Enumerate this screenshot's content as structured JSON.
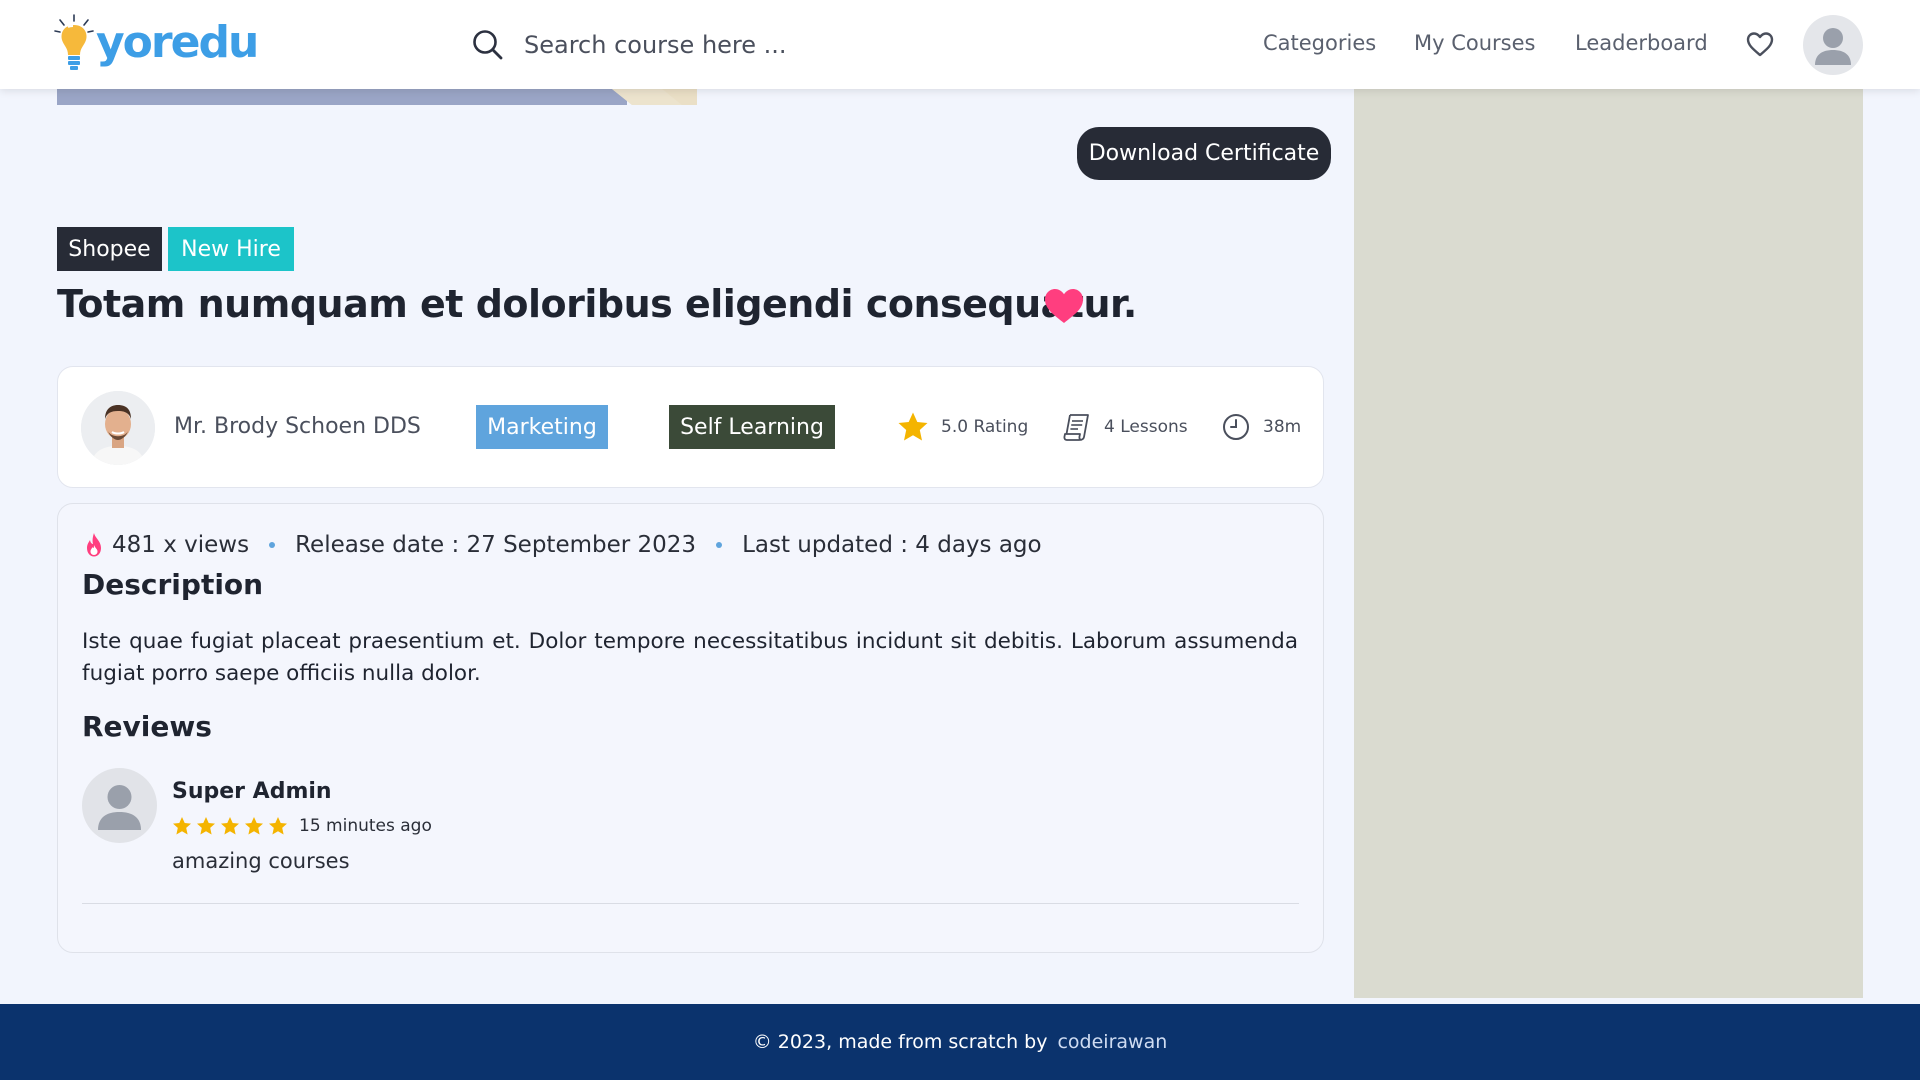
{
  "header": {
    "logo_text": "yoredu",
    "search_placeholder": "Search course here ...",
    "nav": [
      "Categories",
      "My Courses",
      "Leaderboard"
    ],
    "icons": {
      "search": "search-icon",
      "wishlist": "heart-icon",
      "profile": "user-avatar-icon"
    }
  },
  "colors": {
    "brand_blue": "#3d9ee6",
    "dark": "#272b36",
    "teal": "#1cc4c9",
    "marketing_blue": "#5fa4dd",
    "self_learning_green": "#3b4a38",
    "heart_pink": "#ff3e7f",
    "star_yellow": "#f4b400",
    "footer_navy": "#0b336d",
    "side_panel": "#dadbd0"
  },
  "actions": {
    "download_certificate": "Download Certificate"
  },
  "course": {
    "tags": [
      "Shopee",
      "New Hire"
    ],
    "title": "Totam numquam et doloribus eligendi consequatur.",
    "favorited": true,
    "instructor": "Mr. Brody Schoen DDS",
    "category": "Marketing",
    "learning_type": "Self Learning",
    "rating": "5.0 Rating",
    "lessons": "4 Lessons",
    "duration": "38m",
    "views": "481 x views",
    "release_date": "Release date : 27 September 2023",
    "last_updated": "Last updated : 4 days ago",
    "description_heading": "Description",
    "description": "Iste quae fugiat placeat praesentium et. Dolor tempore necessitatibus incidunt sit debitis. Laborum assumenda fugiat porro saepe officiis nulla dolor.",
    "reviews_heading": "Reviews"
  },
  "reviews": [
    {
      "name": "Super Admin",
      "stars": 5,
      "time": "15 minutes ago",
      "text": "amazing courses"
    }
  ],
  "footer": {
    "text": "© 2023, made from scratch by",
    "link": "codeirawan"
  }
}
